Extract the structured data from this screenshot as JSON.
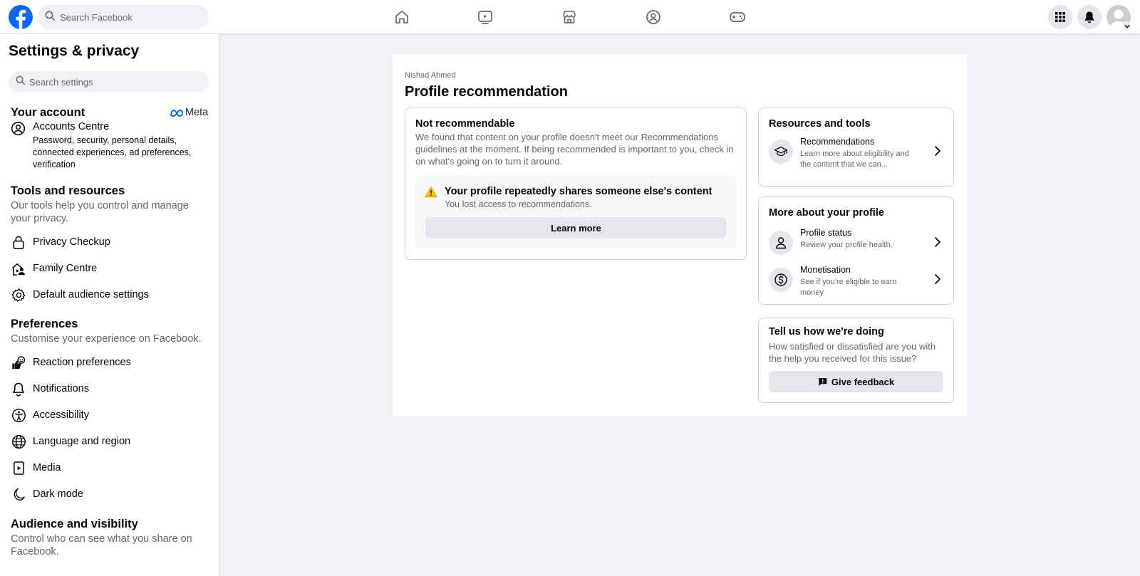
{
  "topbar": {
    "search_placeholder": "Search Facebook",
    "nav_icons": [
      "home-icon",
      "video-icon",
      "marketplace-icon",
      "groups-icon",
      "gaming-icon"
    ],
    "right_icons": [
      "menu-grid-icon",
      "notifications-bell-icon",
      "profile-avatar"
    ]
  },
  "sidebar": {
    "title": "Settings & privacy",
    "search_placeholder": "Search settings",
    "your_account": {
      "title": "Your account",
      "brand": "Meta",
      "accounts_centre": {
        "label": "Accounts Centre",
        "description": "Password, security, personal details, connected experiences, ad preferences, verification"
      }
    },
    "tools": {
      "title": "Tools and resources",
      "subtitle": "Our tools help you control and manage your privacy.",
      "items": [
        {
          "label": "Privacy Checkup",
          "icon": "lock-icon"
        },
        {
          "label": "Family Centre",
          "icon": "family-icon"
        },
        {
          "label": "Default audience settings",
          "icon": "gear-icon"
        }
      ]
    },
    "preferences": {
      "title": "Preferences",
      "subtitle": "Customise your experience on Facebook.",
      "items": [
        {
          "label": "Reaction preferences",
          "icon": "reaction-icon"
        },
        {
          "label": "Notifications",
          "icon": "bell-icon"
        },
        {
          "label": "Accessibility",
          "icon": "accessibility-icon"
        },
        {
          "label": "Language and region",
          "icon": "globe-icon"
        },
        {
          "label": "Media",
          "icon": "media-icon"
        },
        {
          "label": "Dark mode",
          "icon": "moon-icon"
        }
      ]
    },
    "audience": {
      "title": "Audience and visibility",
      "subtitle": "Control who can see what you share on Facebook."
    }
  },
  "main": {
    "owner_name": "Nishad Ahmed",
    "title": "Profile recommendation",
    "status_card": {
      "title": "Not recommendable",
      "text": "We found that content on your profile doesn't meet our Recommendations guidelines at the moment. If being recommended is important to you, check in on what's going on to turn it around.",
      "warning": {
        "title": "Your profile repeatedly shares someone else's content",
        "subtitle": "You lost access to recommendations.",
        "button": "Learn more"
      }
    },
    "resources": {
      "title": "Resources and tools",
      "items": [
        {
          "title": "Recommendations",
          "description": "Learn more about eligibility and the content that we can...",
          "icon": "graduation-cap-icon"
        }
      ]
    },
    "more_profile": {
      "title": "More about your profile",
      "items": [
        {
          "title": "Profile status",
          "description": "Review your profile health.",
          "icon": "person-icon"
        },
        {
          "title": "Monetisation",
          "description": "See if you're eligible to earn money",
          "icon": "dollar-icon"
        }
      ]
    },
    "feedback": {
      "title": "Tell us how we're doing",
      "text": "How satisfied or dissatisfied are you with the help you received for this issue?",
      "button": "Give feedback"
    }
  },
  "colors": {
    "brand_blue": "#0866ff",
    "page_background": "#f0f2f5",
    "warning_yellow": "#f0c400"
  }
}
